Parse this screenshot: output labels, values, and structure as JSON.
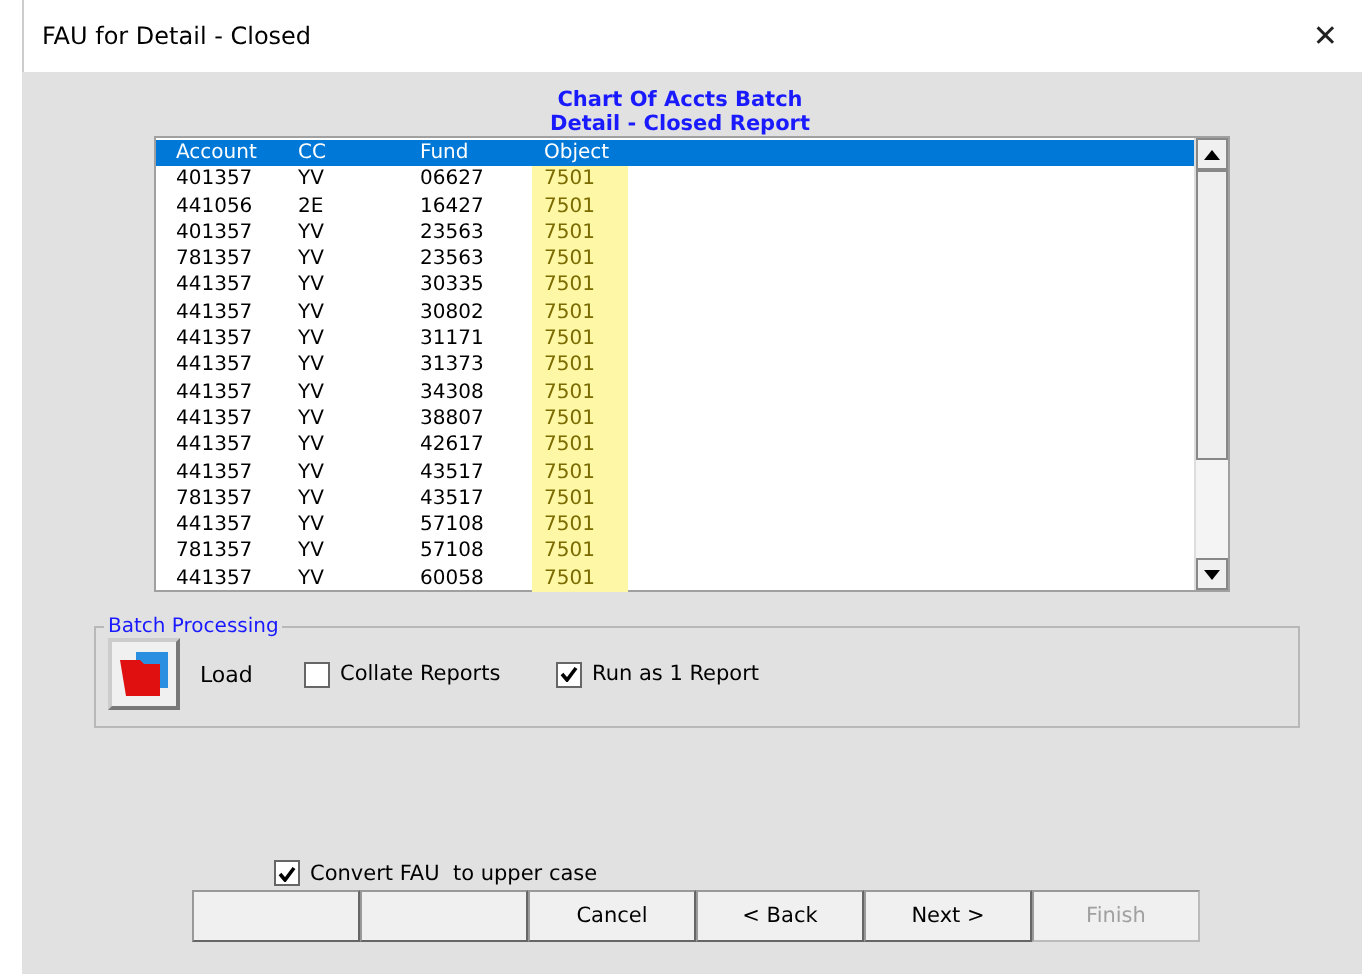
{
  "window": {
    "title": "FAU for Detail - Closed",
    "close": "✕"
  },
  "heading": [
    "Chart Of Accts Batch",
    "Detail - Closed Report"
  ],
  "list": {
    "rows": [
      {
        "cells": [
          "Account",
          "CC",
          "Fund",
          "Object"
        ],
        "selected": true
      },
      {
        "cells": [
          "401357",
          "YV",
          "06627",
          "7501"
        ],
        "selected": false
      },
      {
        "cells": [
          "441056",
          "2E",
          "16427",
          "7501"
        ],
        "selected": false
      },
      {
        "cells": [
          "401357",
          "YV",
          "23563",
          "7501"
        ],
        "selected": false
      },
      {
        "cells": [
          "781357",
          "YV",
          "23563",
          "7501"
        ],
        "selected": false
      },
      {
        "cells": [
          "441357",
          "YV",
          "30335",
          "7501"
        ],
        "selected": false
      },
      {
        "cells": [
          "441357",
          "YV",
          "30802",
          "7501"
        ],
        "selected": false
      },
      {
        "cells": [
          "441357",
          "YV",
          "31171",
          "7501"
        ],
        "selected": false
      },
      {
        "cells": [
          "441357",
          "YV",
          "31373",
          "7501"
        ],
        "selected": false
      },
      {
        "cells": [
          "441357",
          "YV",
          "34308",
          "7501"
        ],
        "selected": false
      },
      {
        "cells": [
          "441357",
          "YV",
          "38807",
          "7501"
        ],
        "selected": false
      },
      {
        "cells": [
          "441357",
          "YV",
          "42617",
          "7501"
        ],
        "selected": false
      },
      {
        "cells": [
          "441357",
          "YV",
          "43517",
          "7501"
        ],
        "selected": false
      },
      {
        "cells": [
          "781357",
          "YV",
          "43517",
          "7501"
        ],
        "selected": false
      },
      {
        "cells": [
          "441357",
          "YV",
          "57108",
          "7501"
        ],
        "selected": false
      },
      {
        "cells": [
          "781357",
          "YV",
          "57108",
          "7501"
        ],
        "selected": false
      },
      {
        "cells": [
          "441357",
          "YV",
          "60058",
          "7501"
        ],
        "selected": false
      }
    ]
  },
  "batch": {
    "title": "Batch Processing",
    "load": "Load",
    "options": [
      {
        "label": "Collate Reports",
        "checked": false
      },
      {
        "label": "Run as 1 Report",
        "checked": true
      }
    ]
  },
  "convert": {
    "label": "Convert FAU  to upper case",
    "checked": true
  },
  "buttons": [
    {
      "disabled": false
    },
    {
      "disabled": false
    },
    {
      "label": "Cancel",
      "disabled": false
    },
    {
      "label": "< Back",
      "disabled": false
    },
    {
      "label": "Next >",
      "disabled": false
    },
    {
      "label": "Finish",
      "disabled": true
    }
  ]
}
